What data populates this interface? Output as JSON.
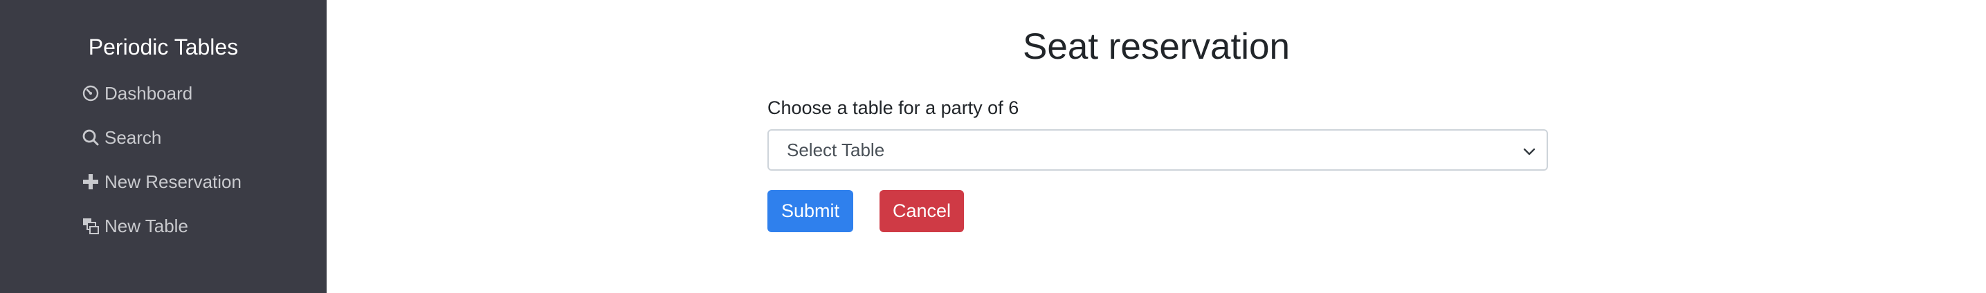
{
  "sidebar": {
    "brand": "Periodic Tables",
    "items": [
      {
        "label": "Dashboard",
        "icon": "dashboard-icon"
      },
      {
        "label": "Search",
        "icon": "search-icon"
      },
      {
        "label": "New Reservation",
        "icon": "plus-icon"
      },
      {
        "label": "New Table",
        "icon": "table-layers-icon"
      }
    ]
  },
  "main": {
    "title": "Seat reservation",
    "form": {
      "label": "Choose a table for a party of 6",
      "select_value": "Select Table",
      "submit_label": "Submit",
      "cancel_label": "Cancel"
    }
  },
  "colors": {
    "sidebar_bg": "#3b3c45",
    "submit_bg": "#2f80ed",
    "cancel_bg": "#cf3a45"
  }
}
